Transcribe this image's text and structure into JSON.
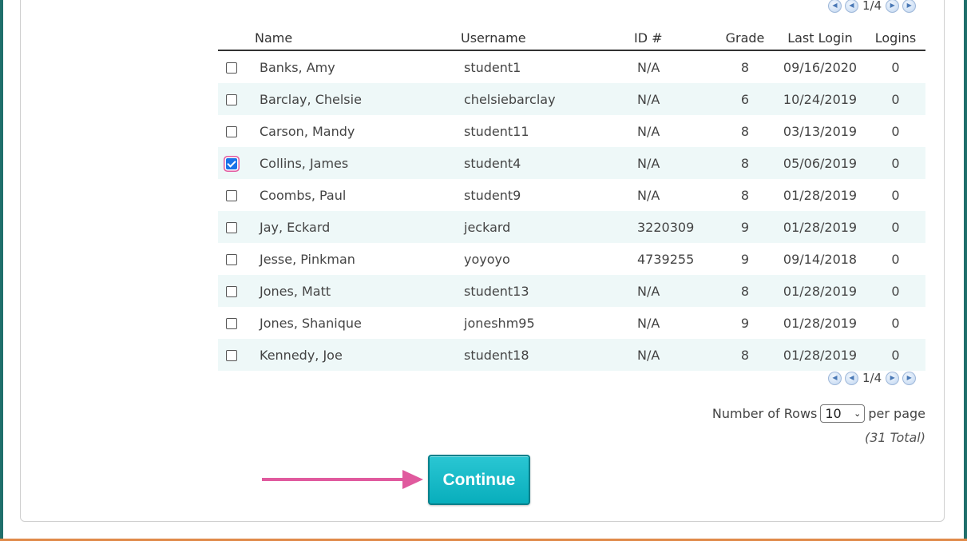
{
  "pager": {
    "text": "1/4",
    "first_icon": "first-page-icon",
    "prev_icon": "prev-page-icon",
    "next_icon": "next-page-icon",
    "last_icon": "last-page-icon"
  },
  "table": {
    "columns": [
      "Name",
      "Username",
      "ID #",
      "Grade",
      "Last Login",
      "Logins"
    ],
    "rows": [
      {
        "checked": false,
        "name": "Banks, Amy",
        "username": "student1",
        "id": "N/A",
        "grade": "8",
        "last_login": "09/16/2020",
        "logins": "0"
      },
      {
        "checked": false,
        "name": "Barclay, Chelsie",
        "username": "chelsiebarclay",
        "id": "N/A",
        "grade": "6",
        "last_login": "10/24/2019",
        "logins": "0"
      },
      {
        "checked": false,
        "name": "Carson, Mandy",
        "username": "student11",
        "id": "N/A",
        "grade": "8",
        "last_login": "03/13/2019",
        "logins": "0"
      },
      {
        "checked": true,
        "name": "Collins, James",
        "username": "student4",
        "id": "N/A",
        "grade": "8",
        "last_login": "05/06/2019",
        "logins": "0"
      },
      {
        "checked": false,
        "name": "Coombs, Paul",
        "username": "student9",
        "id": "N/A",
        "grade": "8",
        "last_login": "01/28/2019",
        "logins": "0"
      },
      {
        "checked": false,
        "name": "Jay, Eckard",
        "username": "jeckard",
        "id": "3220309",
        "grade": "9",
        "last_login": "01/28/2019",
        "logins": "0"
      },
      {
        "checked": false,
        "name": "Jesse, Pinkman",
        "username": "yoyoyo",
        "id": "4739255",
        "grade": "9",
        "last_login": "09/14/2018",
        "logins": "0"
      },
      {
        "checked": false,
        "name": "Jones, Matt",
        "username": "student13",
        "id": "N/A",
        "grade": "8",
        "last_login": "01/28/2019",
        "logins": "0"
      },
      {
        "checked": false,
        "name": "Jones, Shanique",
        "username": "joneshm95",
        "id": "N/A",
        "grade": "9",
        "last_login": "01/28/2019",
        "logins": "0"
      },
      {
        "checked": false,
        "name": "Kennedy, Joe",
        "username": "student18",
        "id": "N/A",
        "grade": "8",
        "last_login": "01/28/2019",
        "logins": "0"
      }
    ]
  },
  "rows_control": {
    "label": "Number of Rows",
    "selected": "10",
    "suffix": "per page"
  },
  "total": "(31 Total)",
  "continue_label": "Continue",
  "colors": {
    "accent": "#08aebc",
    "arrow": "#e05a9e",
    "row_alt": "#eef8f8",
    "frame": "#1f6f6b"
  }
}
